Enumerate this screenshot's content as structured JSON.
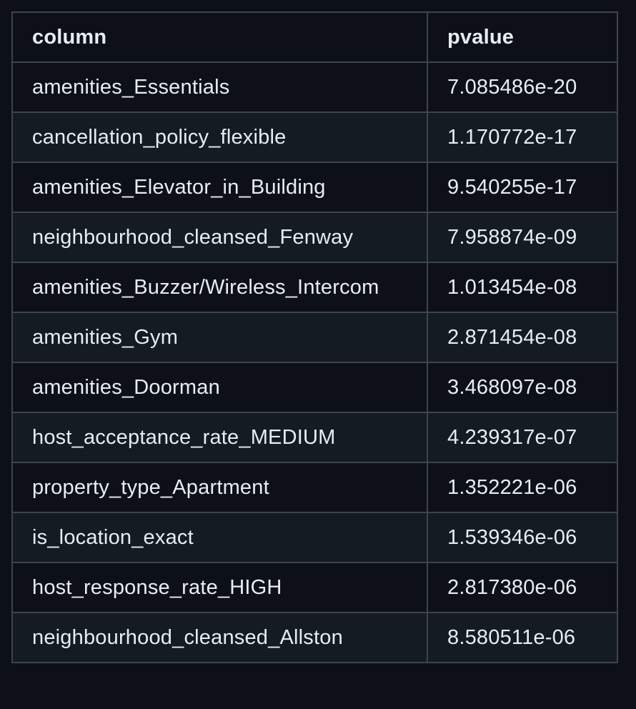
{
  "table": {
    "headers": [
      "column",
      "pvalue"
    ],
    "rows": [
      {
        "column": "amenities_Essentials",
        "pvalue": "7.085486e-20"
      },
      {
        "column": "cancellation_policy_flexible",
        "pvalue": "1.170772e-17"
      },
      {
        "column": "amenities_Elevator_in_Building",
        "pvalue": "9.540255e-17"
      },
      {
        "column": "neighbourhood_cleansed_Fenway",
        "pvalue": "7.958874e-09"
      },
      {
        "column": "amenities_Buzzer/Wireless_Intercom",
        "pvalue": "1.013454e-08"
      },
      {
        "column": "amenities_Gym",
        "pvalue": "2.871454e-08"
      },
      {
        "column": "amenities_Doorman",
        "pvalue": "3.468097e-08"
      },
      {
        "column": "host_acceptance_rate_MEDIUM",
        "pvalue": "4.239317e-07"
      },
      {
        "column": "property_type_Apartment",
        "pvalue": "1.352221e-06"
      },
      {
        "column": "is_location_exact",
        "pvalue": "1.539346e-06"
      },
      {
        "column": "host_response_rate_HIGH",
        "pvalue": "2.817380e-06"
      },
      {
        "column": "neighbourhood_cleansed_Allston",
        "pvalue": "8.580511e-06"
      }
    ]
  },
  "colors": {
    "background": "#0d1117",
    "row_alt": "#151b23",
    "border": "#3d444d",
    "text": "#e6edf3"
  }
}
